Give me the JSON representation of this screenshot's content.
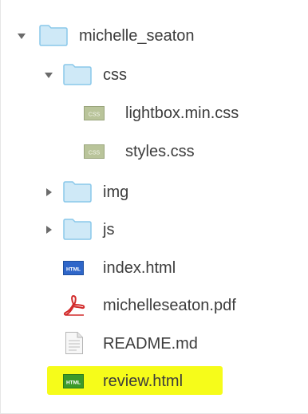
{
  "tree": {
    "root": {
      "label": "michelle_seaton",
      "icon": "folder-icon",
      "expanded": true
    },
    "css_folder": {
      "label": "css",
      "icon": "folder-icon",
      "expanded": true,
      "files": [
        {
          "label": "lightbox.min.css",
          "icon": "css-file-icon",
          "badge": "CSS"
        },
        {
          "label": "styles.css",
          "icon": "css-file-icon",
          "badge": "CSS"
        }
      ]
    },
    "img_folder": {
      "label": "img",
      "icon": "folder-icon",
      "expanded": false
    },
    "js_folder": {
      "label": "js",
      "icon": "folder-icon",
      "expanded": false
    },
    "files": [
      {
        "label": "index.html",
        "icon": "html-file-icon",
        "badge": "HTML"
      },
      {
        "label": "michelleseaton.pdf",
        "icon": "pdf-file-icon"
      },
      {
        "label": "README.md",
        "icon": "text-file-icon"
      },
      {
        "label": "review.html",
        "icon": "html-file-icon",
        "badge": "HTML",
        "highlighted": true
      }
    ]
  },
  "colors": {
    "folder_fill": "#cfe9f7",
    "folder_stroke": "#8ac8ea",
    "text": "#3c3c3c",
    "highlight": "#f6fc1a",
    "css_badge": "#b9c49a",
    "html_badge_blue": "#2f66c9",
    "html_badge_green": "#3c9a2a",
    "pdf_red": "#d22b2b"
  }
}
